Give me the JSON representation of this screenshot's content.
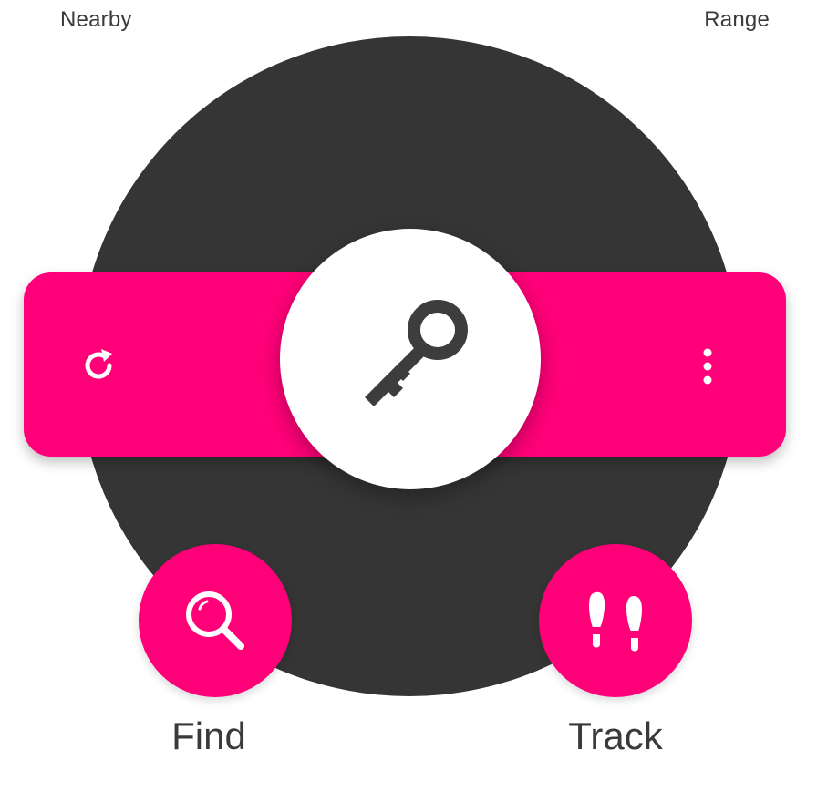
{
  "header": {
    "left_label": "Nearby",
    "right_label": "Range"
  },
  "center": {
    "icon": "key-icon"
  },
  "band": {
    "left_icon": "refresh-icon",
    "right_icon": "more-vertical-icon"
  },
  "actions": [
    {
      "label": "Find",
      "icon": "search-icon"
    },
    {
      "label": "Track",
      "icon": "footprints-icon"
    }
  ],
  "colors": {
    "accent": "#ff0078",
    "disc": "#353535",
    "icon_dark": "#3d3d3d",
    "text": "#3a3a3a",
    "background": "#ffffff"
  }
}
